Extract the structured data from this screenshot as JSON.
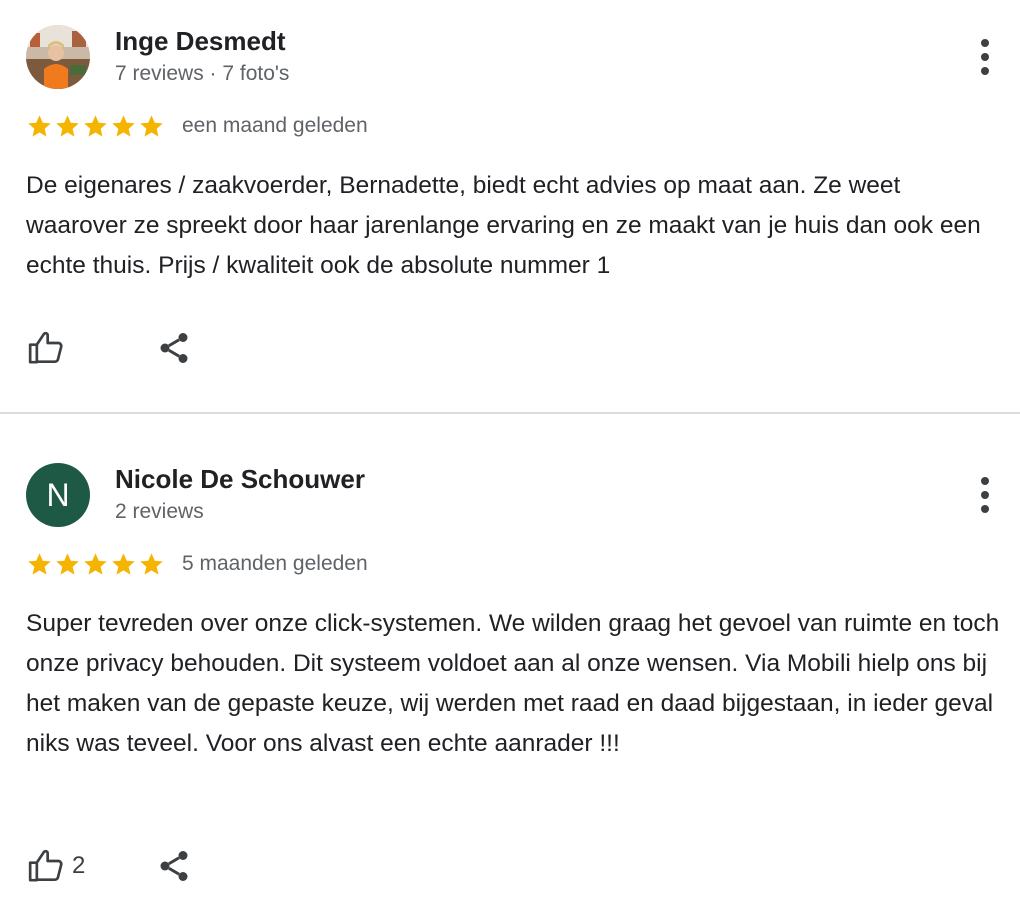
{
  "reviews": [
    {
      "author": "Inge Desmedt",
      "meta": "7 reviews · 7 foto's",
      "rating": 5,
      "date": "een maand geleden",
      "text": "De eigenares / zaakvoerder, Bernadette, biedt echt advies op maat aan. Ze weet waarover ze spreekt door haar jarenlange ervaring en ze maakt van je huis dan ook een echte thuis. Prijs / kwaliteit ook de absolute nummer 1",
      "likes": ""
    },
    {
      "author": "Nicole De Schouwer",
      "avatar_initial": "N",
      "avatar_color": "#1e5945",
      "meta": "2 reviews",
      "rating": 5,
      "date": "5 maanden geleden",
      "text": "Super tevreden over onze click-systemen. We wilden graag het gevoel van ruimte en toch onze privacy behouden. Dit systeem voldoet aan al onze wensen. Via Mobili hielp ons bij het maken van de gepaste keuze, wij werden met raad en daad bijgestaan, in ieder geval niks was teveel. Voor ons alvast een echte aanrader !!!",
      "likes": "2"
    }
  ],
  "colors": {
    "star": "#f4b400",
    "text": "#202124",
    "muted": "#5f6368",
    "divider": "#dadce0"
  },
  "icons": {
    "like": "thumbs-up-icon",
    "share": "share-icon",
    "more": "more-vert-icon"
  }
}
